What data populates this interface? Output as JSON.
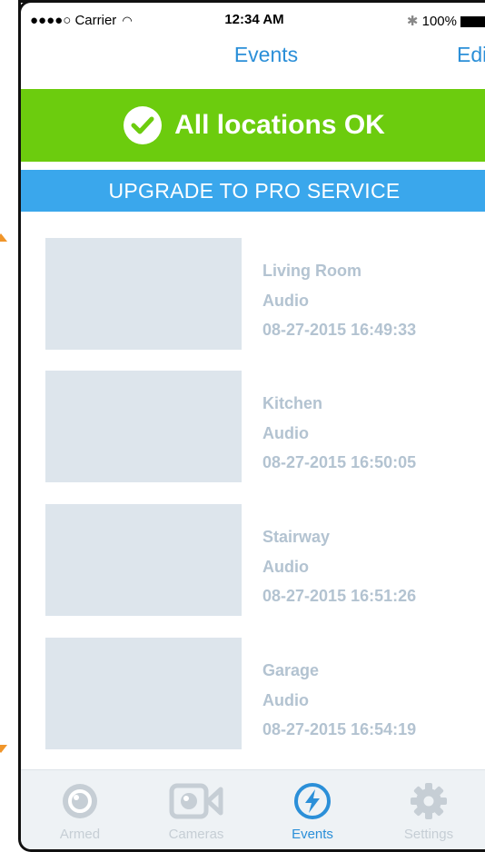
{
  "status_bar": {
    "carrier": "●●●●○ Carrier",
    "time": "12:34 AM",
    "battery": "100%"
  },
  "nav": {
    "title": "Events",
    "edit_label": "Edit"
  },
  "status_banner": {
    "text": "All locations OK",
    "icon": "check-circle-icon",
    "color": "#6ccc0e"
  },
  "upgrade_banner": {
    "text": "UPGRADE TO PRO SERVICE",
    "color": "#3aa7ec"
  },
  "events": [
    {
      "location": "Living Room",
      "type": "Audio",
      "timestamp": "08-27-2015 16:49:33"
    },
    {
      "location": "Kitchen",
      "type": "Audio",
      "timestamp": "08-27-2015 16:50:05"
    },
    {
      "location": "Stairway",
      "type": "Audio",
      "timestamp": "08-27-2015 16:51:26"
    },
    {
      "location": "Garage",
      "type": "Audio",
      "timestamp": "08-27-2015 16:54:19"
    }
  ],
  "tabs": [
    {
      "label": "Armed",
      "icon": "armed-icon",
      "active": false
    },
    {
      "label": "Cameras",
      "icon": "camera-icon",
      "active": false
    },
    {
      "label": "Events",
      "icon": "lightning-icon",
      "active": true
    },
    {
      "label": "Settings",
      "icon": "gear-icon",
      "active": false
    }
  ],
  "colors": {
    "accent": "#2b8fd8",
    "inactive_tab": "#c6ced5",
    "event_text": "#b3c3d1",
    "thumbnail": "#dde5ec"
  }
}
